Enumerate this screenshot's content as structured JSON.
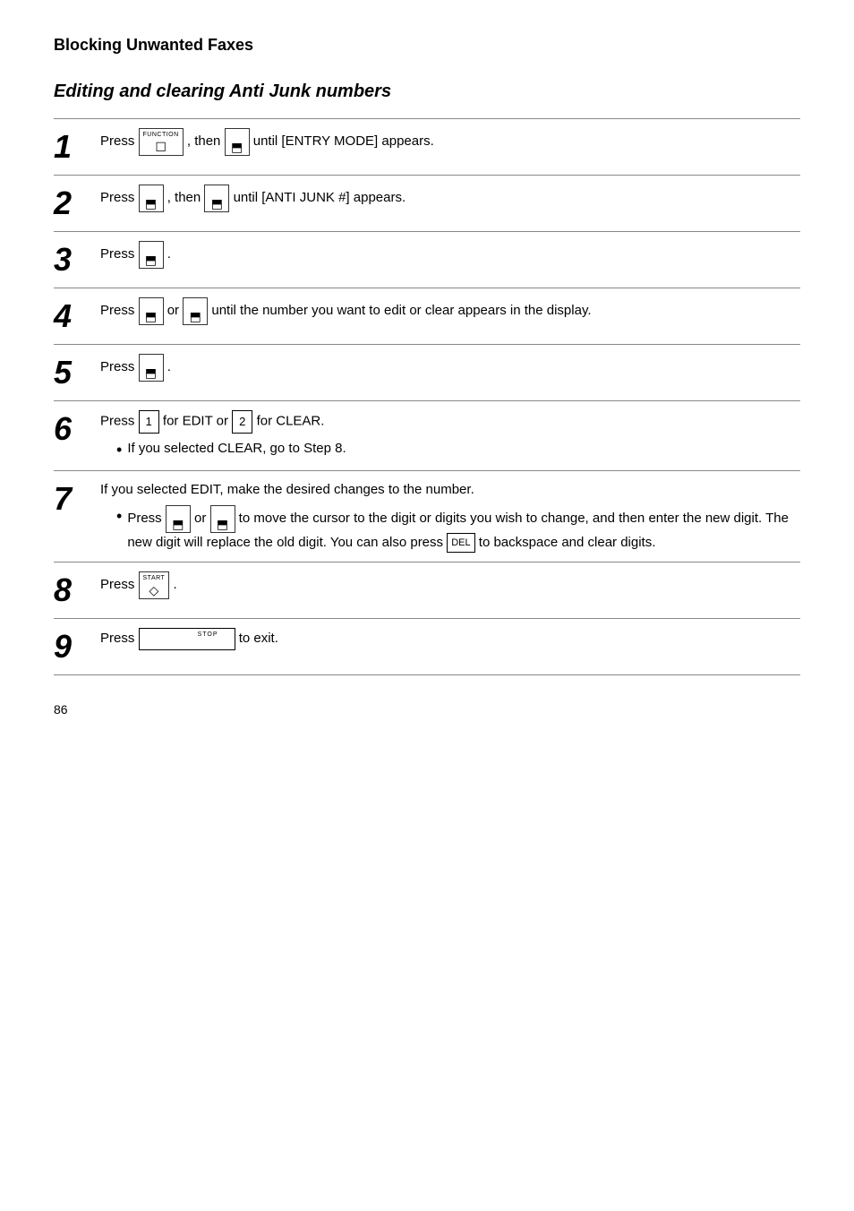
{
  "page": {
    "title": "Blocking Unwanted Faxes",
    "section_title": "Editing and clearing Anti Junk numbers",
    "page_num": "86"
  },
  "steps": [
    {
      "num": "1",
      "text_before": "Press",
      "btn1": {
        "label": "FUNCTION",
        "sym": "☐"
      },
      "then": ", then",
      "btn2": {
        "sym": "⬚"
      },
      "text_after": "until [ENTRY MODE] appears."
    },
    {
      "num": "2",
      "text_before": "Press",
      "btn1": {
        "sym": "⬚"
      },
      "then": ", then",
      "btn2": {
        "sym": "⬚"
      },
      "text_after": "until [ANTI JUNK #] appears."
    },
    {
      "num": "3",
      "text_before": "Press",
      "btn1": {
        "sym": "⬚"
      },
      "text_after": "."
    },
    {
      "num": "4",
      "text_before": "Press",
      "btn1": {
        "sym": "⬚"
      },
      "or": "or",
      "btn2": {
        "sym": "⬚"
      },
      "text_after": "until the number you want to edit or clear appears in the display."
    },
    {
      "num": "5",
      "text_before": "Press",
      "btn1": {
        "sym": "⬚"
      },
      "text_after": "."
    },
    {
      "num": "6",
      "text_before": "Press",
      "btn1": "1",
      "for1": "for EDIT or",
      "btn2": "2",
      "for2": "for CLEAR.",
      "bullet": "If you selected CLEAR, go to Step 8."
    },
    {
      "num": "7",
      "text": "If you selected EDIT, make the desired changes to the number.",
      "bullet": "Press",
      "btn1": {
        "sym": "⬚"
      },
      "or": "or",
      "btn2": {
        "sym": "⬚"
      },
      "bullet_end": "to move the cursor to the digit or digits you wish to change, and then enter the new digit. The new digit will replace the old digit. You can also press",
      "btn3": "DEL",
      "bullet_end2": "to backspace and clear digits."
    },
    {
      "num": "8",
      "text_before": "Press",
      "btn_start_label": "START",
      "btn_start_sym": "◇",
      "text_after": "."
    },
    {
      "num": "9",
      "text_before": "Press",
      "btn_stop": "STOP",
      "text_after": "to exit."
    }
  ]
}
